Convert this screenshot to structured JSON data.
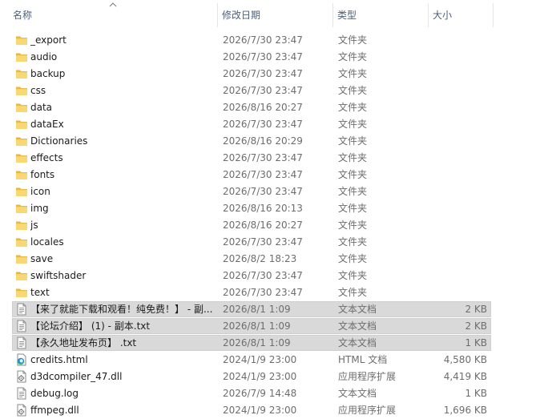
{
  "columns": {
    "name": "名称",
    "date": "修改日期",
    "type": "类型",
    "size": "大小"
  },
  "files": [
    {
      "name": "_export",
      "date": "2026/7/30 23:47",
      "type": "文件夹",
      "size": "",
      "icon": "folder-icon",
      "selected": false
    },
    {
      "name": "audio",
      "date": "2026/7/30 23:47",
      "type": "文件夹",
      "size": "",
      "icon": "folder-icon",
      "selected": false
    },
    {
      "name": "backup",
      "date": "2026/7/30 23:47",
      "type": "文件夹",
      "size": "",
      "icon": "folder-icon",
      "selected": false
    },
    {
      "name": "css",
      "date": "2026/7/30 23:47",
      "type": "文件夹",
      "size": "",
      "icon": "folder-icon",
      "selected": false
    },
    {
      "name": "data",
      "date": "2026/8/16 20:27",
      "type": "文件夹",
      "size": "",
      "icon": "folder-icon",
      "selected": false
    },
    {
      "name": "dataEx",
      "date": "2026/7/30 23:47",
      "type": "文件夹",
      "size": "",
      "icon": "folder-icon",
      "selected": false
    },
    {
      "name": "Dictionaries",
      "date": "2026/8/16 20:29",
      "type": "文件夹",
      "size": "",
      "icon": "folder-icon",
      "selected": false
    },
    {
      "name": "effects",
      "date": "2026/7/30 23:47",
      "type": "文件夹",
      "size": "",
      "icon": "folder-icon",
      "selected": false
    },
    {
      "name": "fonts",
      "date": "2026/7/30 23:47",
      "type": "文件夹",
      "size": "",
      "icon": "folder-icon",
      "selected": false
    },
    {
      "name": "icon",
      "date": "2026/7/30 23:47",
      "type": "文件夹",
      "size": "",
      "icon": "folder-icon",
      "selected": false
    },
    {
      "name": "img",
      "date": "2026/8/16 20:13",
      "type": "文件夹",
      "size": "",
      "icon": "folder-icon",
      "selected": false
    },
    {
      "name": "js",
      "date": "2026/8/16 20:27",
      "type": "文件夹",
      "size": "",
      "icon": "folder-icon",
      "selected": false
    },
    {
      "name": "locales",
      "date": "2026/7/30 23:47",
      "type": "文件夹",
      "size": "",
      "icon": "folder-icon",
      "selected": false
    },
    {
      "name": "save",
      "date": "2026/8/2 18:23",
      "type": "文件夹",
      "size": "",
      "icon": "folder-icon",
      "selected": false
    },
    {
      "name": "swiftshader",
      "date": "2026/7/30 23:47",
      "type": "文件夹",
      "size": "",
      "icon": "folder-icon",
      "selected": false
    },
    {
      "name": "text",
      "date": "2026/7/30 23:47",
      "type": "文件夹",
      "size": "",
      "icon": "folder-icon",
      "selected": false
    },
    {
      "name": "【来了就能下载和观看！纯免费！】 - 副...",
      "date": "2026/8/1 1:09",
      "type": "文本文档",
      "size": "2 KB",
      "icon": "text-file-icon",
      "selected": true
    },
    {
      "name": "【论坛介绍】 (1) - 副本.txt",
      "date": "2026/8/1 1:09",
      "type": "文本文档",
      "size": "2 KB",
      "icon": "text-file-icon",
      "selected": true
    },
    {
      "name": "【永久地址发布页】 .txt",
      "date": "2026/8/1 1:09",
      "type": "文本文档",
      "size": "1 KB",
      "icon": "text-file-icon",
      "selected": true
    },
    {
      "name": "credits.html",
      "date": "2024/1/9 23:00",
      "type": "HTML 文档",
      "size": "4,580 KB",
      "icon": "edge-html-icon",
      "selected": false
    },
    {
      "name": "d3dcompiler_47.dll",
      "date": "2024/1/9 23:00",
      "type": "应用程序扩展",
      "size": "4,419 KB",
      "icon": "dll-file-icon",
      "selected": false
    },
    {
      "name": "debug.log",
      "date": "2026/7/9 14:48",
      "type": "文本文档",
      "size": "1 KB",
      "icon": "text-file-icon",
      "selected": false
    },
    {
      "name": "ffmpeg.dll",
      "date": "2024/1/9 23:00",
      "type": "应用程序扩展",
      "size": "1,696 KB",
      "icon": "dll-file-icon",
      "selected": false
    }
  ]
}
